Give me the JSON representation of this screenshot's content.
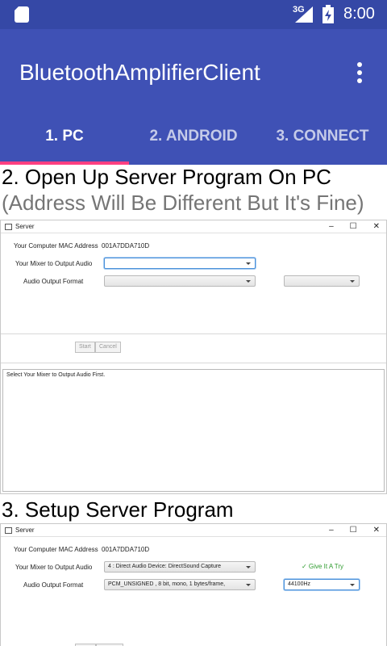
{
  "status_bar": {
    "network": "3G",
    "time": "8:00"
  },
  "app_bar": {
    "title": "BluetoothAmplifierClient",
    "tabs": [
      {
        "label": "1. PC",
        "active": true
      },
      {
        "label": "2. ANDROID",
        "active": false
      },
      {
        "label": "3. CONNECT",
        "active": false
      }
    ]
  },
  "content": {
    "step2_heading": "2. Open Up Server Program On PC",
    "step2_subheading": "(Address Will Be Different But It's Fine)",
    "step3_heading": "3. Setup Server Program"
  },
  "server_window_1": {
    "title": "Server",
    "controls": [
      "–",
      "☐",
      "✕"
    ],
    "mac_label": "Your Computer MAC Address",
    "mac_value": "001A7DDA710D",
    "mixer_label": "Your Mixer to Output Audio",
    "mixer_value": "",
    "format_label": "Audio Output Format",
    "format_value": "",
    "rate_value": "",
    "start_label": "Start",
    "cancel_label": "Cancel",
    "log_text": "Select Your Mixer to Output Audio First."
  },
  "server_window_2": {
    "title": "Server",
    "controls": [
      "–",
      "☐",
      "✕"
    ],
    "mac_label": "Your Computer MAC Address",
    "mac_value": "001A7DDA710D",
    "mixer_label": "Your Mixer to Output Audio",
    "mixer_value": "4 : Direct Audio Device: DirectSound Capture",
    "format_label": "Audio Output Format",
    "format_value": "PCM_UNSIGNED , 8 bit, mono, 1 bytes/frame,",
    "rate_value": "44100Hz",
    "status_text": "✓ Give It A Try"
  },
  "colors": {
    "status_bar": "#3548a6",
    "app_bar": "#3f51b5",
    "tab_indicator": "#ff4081",
    "ok_green": "#2e9b2e"
  }
}
